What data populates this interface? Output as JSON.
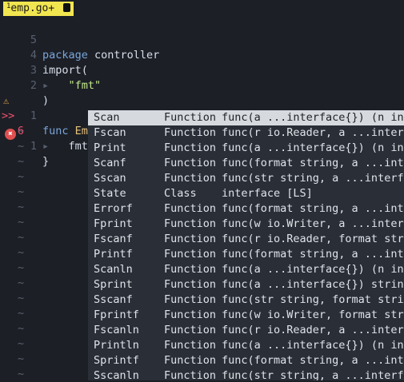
{
  "tab": {
    "number": "1",
    "name": "emp.go+"
  },
  "lines": [
    {
      "num": "5",
      "text_kw": "package",
      "text_rest": " controller"
    },
    {
      "num": "4",
      "text": "import("
    },
    {
      "num": "3",
      "text_str": "\"fmt\""
    },
    {
      "num": "2",
      "text": ")"
    },
    {
      "num": "1",
      "sign": "⚠",
      "text_kw": "func",
      "text_fn": "Empcontoller",
      "text_rest": "() {"
    },
    {
      "num": "6",
      "sign": ">>",
      "text": "fmt."
    },
    {
      "num": "1",
      "sign": "err",
      "text": "}"
    }
  ],
  "tilde": "~",
  "popup": {
    "items": [
      {
        "word": "Scan",
        "kind": "Function",
        "menu": "func(a ...interface{}) (n int"
      },
      {
        "word": "Fscan",
        "kind": "Function",
        "menu": "func(r io.Reader, a ...interf"
      },
      {
        "word": "Print",
        "kind": "Function",
        "menu": "func(a ...interface{}) (n int"
      },
      {
        "word": "Scanf",
        "kind": "Function",
        "menu": "func(format string, a ...inte"
      },
      {
        "word": "Sscan",
        "kind": "Function",
        "menu": "func(str string, a ...interfa"
      },
      {
        "word": "State",
        "kind": "Class",
        "menu": "interface [LS]"
      },
      {
        "word": "Errorf",
        "kind": "Function",
        "menu": "func(format string, a ...inte"
      },
      {
        "word": "Fprint",
        "kind": "Function",
        "menu": "func(w io.Writer, a ...interf"
      },
      {
        "word": "Fscanf",
        "kind": "Function",
        "menu": "func(r io.Reader, format stri"
      },
      {
        "word": "Printf",
        "kind": "Function",
        "menu": "func(format string, a ...inte"
      },
      {
        "word": "Scanln",
        "kind": "Function",
        "menu": "func(a ...interface{}) (n int"
      },
      {
        "word": "Sprint",
        "kind": "Function",
        "menu": "func(a ...interface{}) string"
      },
      {
        "word": "Sscanf",
        "kind": "Function",
        "menu": "func(str string, format strin"
      },
      {
        "word": "Fprintf",
        "kind": "Function",
        "menu": "func(w io.Writer, format stri"
      },
      {
        "word": "Fscanln",
        "kind": "Function",
        "menu": "func(r io.Reader, a ...interf"
      },
      {
        "word": "Println",
        "kind": "Function",
        "menu": "func(a ...interface{}) (n int"
      },
      {
        "word": "Sprintf",
        "kind": "Function",
        "menu": "func(format string, a ...inte"
      },
      {
        "word": "Sscanln",
        "kind": "Function",
        "menu": "func(str string, a ...interfa"
      }
    ]
  }
}
